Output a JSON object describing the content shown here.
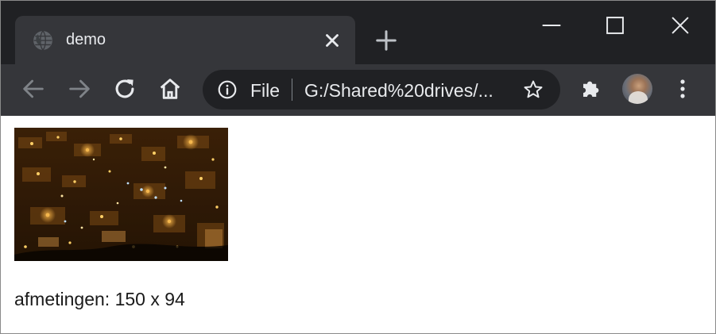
{
  "tab": {
    "title": "demo",
    "favicon": "globe-icon"
  },
  "window_controls": [
    "minimize-icon",
    "maximize-icon",
    "close-icon"
  ],
  "toolbar": {
    "back": "back-arrow-icon",
    "forward": "forward-arrow-icon",
    "reload": "reload-icon",
    "home": "home-icon",
    "extensions": "puzzle-icon",
    "menu": "kebab-menu-icon"
  },
  "omnibox": {
    "scheme_label": "File",
    "url": "G:/Shared%20drives/...",
    "info_icon": "info-icon",
    "bookmark_icon": "star-icon"
  },
  "page": {
    "image_description": "night-city-lights-photo",
    "caption": "afmetingen: 150 x 94"
  },
  "colors": {
    "titlebar": "#202124",
    "toolbar": "#35363a",
    "omnibox": "#202124",
    "text_light": "#e8eaed",
    "icon_dim": "#7f8388"
  }
}
